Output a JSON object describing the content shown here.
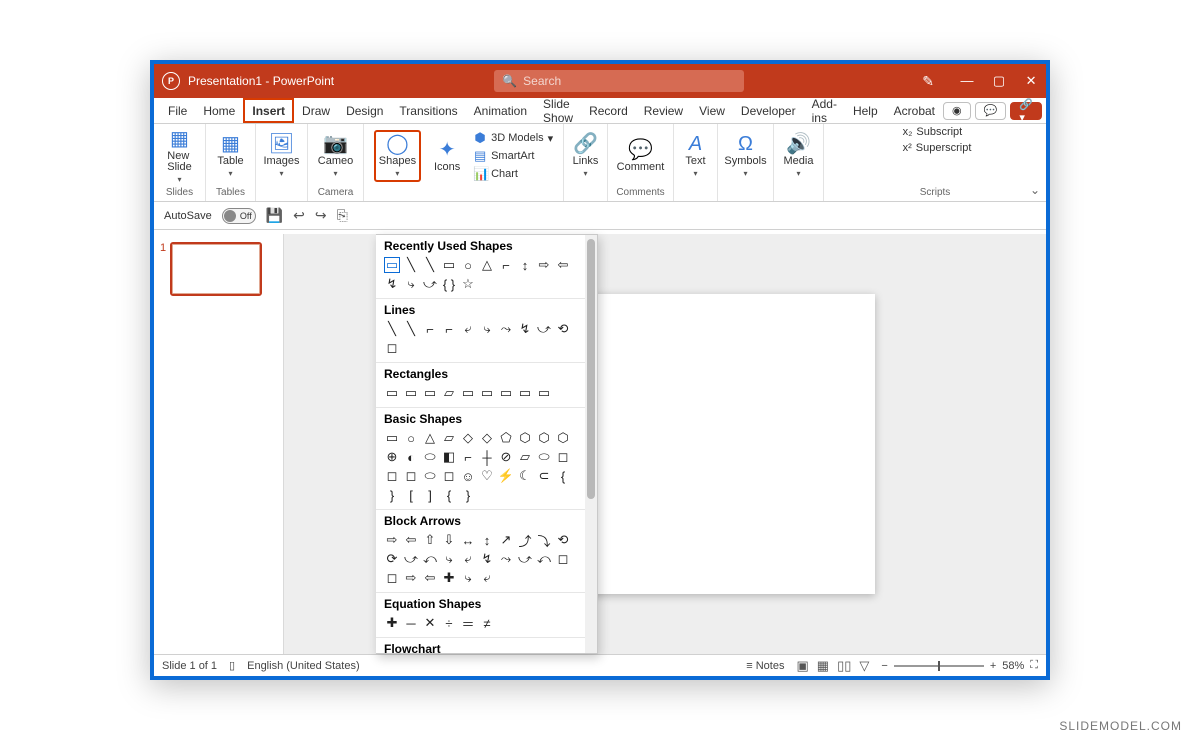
{
  "titlebar": {
    "app_icon": "P",
    "title": "Presentation1 - PowerPoint",
    "search_placeholder": "Search"
  },
  "tabs": {
    "items": [
      "File",
      "Home",
      "Insert",
      "Draw",
      "Design",
      "Transitions",
      "Animation",
      "Slide Show",
      "Record",
      "Review",
      "View",
      "Developer",
      "Add-ins",
      "Help",
      "Acrobat"
    ],
    "active": "Insert"
  },
  "ribbon": {
    "groups": {
      "slides": {
        "label": "Slides",
        "new_slide": "New\nSlide"
      },
      "tables": {
        "label": "Tables",
        "table": "Table"
      },
      "images": {
        "label": "",
        "images": "Images"
      },
      "camera": {
        "label": "Camera",
        "cameo": "Cameo"
      },
      "illustrations": {
        "shapes": "Shapes",
        "icons": "Icons",
        "models": "3D Models",
        "smartart": "SmartArt",
        "chart": "Chart"
      },
      "links": {
        "label": "",
        "links": "Links"
      },
      "comments": {
        "label": "Comments",
        "comment": "Comment"
      },
      "text": {
        "label": "",
        "text": "Text"
      },
      "symbols": {
        "label": "",
        "symbols": "Symbols"
      },
      "media": {
        "label": "",
        "media": "Media"
      },
      "scripts": {
        "label": "Scripts",
        "sub": "Subscript",
        "sup": "Superscript"
      }
    }
  },
  "qat": {
    "autosave_label": "AutoSave",
    "autosave_value": "Off"
  },
  "shapes_popup": {
    "sections": [
      {
        "title": "Recently Used Shapes",
        "shapes": [
          "▭",
          "╲",
          "╲",
          "▭",
          "○",
          "△",
          "⌐",
          "↕",
          "⇨",
          "⇦",
          "↯",
          "⤷",
          "⤻",
          "{ }",
          "☆"
        ]
      },
      {
        "title": "Lines",
        "shapes": [
          "╲",
          "╲",
          "⌐",
          "⌐",
          "⤶",
          "⤷",
          "⤳",
          "↯",
          "⤻",
          "⟲",
          "◻"
        ]
      },
      {
        "title": "Rectangles",
        "shapes": [
          "▭",
          "▭",
          "▭",
          "▱",
          "▭",
          "▭",
          "▭",
          "▭",
          "▭"
        ]
      },
      {
        "title": "Basic Shapes",
        "shapes": [
          "▭",
          "○",
          "△",
          "▱",
          "◇",
          "◇",
          "⬠",
          "⬡",
          "⬡",
          "⬡",
          "⊕",
          "◐",
          "⬭",
          "◧",
          "⌐",
          "┼",
          "⊘",
          "▱",
          "⬭",
          "◻",
          "◻",
          "◻",
          "⬭",
          "◻",
          "☺",
          "♡",
          "⚡",
          "☾",
          "⊂",
          "{",
          "}",
          "[",
          "]",
          "{",
          "}"
        ]
      },
      {
        "title": "Block Arrows",
        "shapes": [
          "⇨",
          "⇦",
          "⇧",
          "⇩",
          "↔",
          "↕",
          "↗",
          "⤴",
          "⤵",
          "⟲",
          "⟳",
          "⤻",
          "⤺",
          "⤷",
          "⤶",
          "↯",
          "⤳",
          "⤻",
          "⤺",
          "◻",
          "◻",
          "⇨",
          "⇦",
          "✚",
          "⤷",
          "⤶"
        ]
      },
      {
        "title": "Equation Shapes",
        "shapes": [
          "✚",
          "─",
          "✕",
          "÷",
          "＝",
          "≠"
        ]
      },
      {
        "title": "Flowchart",
        "shapes": [
          "▭",
          "▭",
          "◇",
          "▱",
          "▭",
          "▭",
          "▭",
          "⬭",
          "○",
          "◁",
          "▭"
        ]
      }
    ]
  },
  "thumbnails": {
    "current": "1"
  },
  "statusbar": {
    "slide": "Slide 1 of 1",
    "lang": "English (United States)",
    "notes": "Notes",
    "zoom": "58%"
  },
  "watermark": "SLIDEMODEL.COM"
}
